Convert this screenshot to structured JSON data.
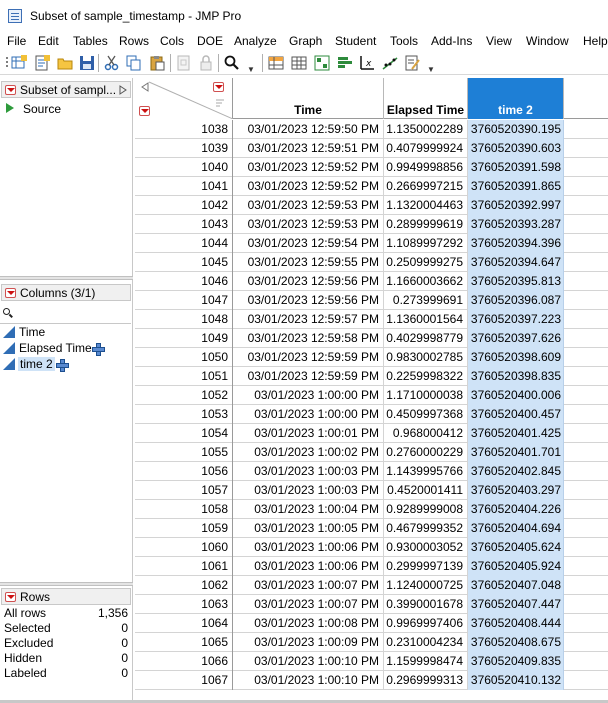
{
  "window": {
    "title": "Subset of sample_timestamp - JMP Pro"
  },
  "menu": [
    "File",
    "Edit",
    "Tables",
    "Rows",
    "Cols",
    "DOE",
    "Analyze",
    "Graph",
    "Student",
    "Tools",
    "Add-Ins",
    "View",
    "Window",
    "Help"
  ],
  "table_panel": {
    "title": "Subset of sampl...",
    "source_label": "Source"
  },
  "columns_panel": {
    "title": "Columns (3/1)",
    "search_value": "",
    "items": [
      {
        "name": "Time",
        "selected": false,
        "has_formula": false
      },
      {
        "name": "Elapsed Time",
        "selected": false,
        "has_formula": true
      },
      {
        "name": "time 2",
        "selected": true,
        "has_formula": true
      }
    ]
  },
  "rows_panel": {
    "title": "Rows",
    "stats": [
      {
        "label": "All rows",
        "value": "1,356"
      },
      {
        "label": "Selected",
        "value": "0"
      },
      {
        "label": "Excluded",
        "value": "0"
      },
      {
        "label": "Hidden",
        "value": "0"
      },
      {
        "label": "Labeled",
        "value": "0"
      }
    ]
  },
  "grid": {
    "headers": {
      "time": "Time",
      "elapsed": "Elapsed Time",
      "time2": "time 2"
    },
    "selected_column": "time 2",
    "selection_color": "#1e7fd6",
    "rows": [
      {
        "n": "1038",
        "time": "03/01/2023 12:59:50 PM",
        "elapsed": "1.1350002289",
        "time2": "3760520390.195"
      },
      {
        "n": "1039",
        "time": "03/01/2023 12:59:51 PM",
        "elapsed": "0.4079999924",
        "time2": "3760520390.603"
      },
      {
        "n": "1040",
        "time": "03/01/2023 12:59:52 PM",
        "elapsed": "0.9949998856",
        "time2": "3760520391.598"
      },
      {
        "n": "1041",
        "time": "03/01/2023 12:59:52 PM",
        "elapsed": "0.2669997215",
        "time2": "3760520391.865"
      },
      {
        "n": "1042",
        "time": "03/01/2023 12:59:53 PM",
        "elapsed": "1.1320004463",
        "time2": "3760520392.997"
      },
      {
        "n": "1043",
        "time": "03/01/2023 12:59:53 PM",
        "elapsed": "0.2899999619",
        "time2": "3760520393.287"
      },
      {
        "n": "1044",
        "time": "03/01/2023 12:59:54 PM",
        "elapsed": "1.1089997292",
        "time2": "3760520394.396"
      },
      {
        "n": "1045",
        "time": "03/01/2023 12:59:55 PM",
        "elapsed": "0.2509999275",
        "time2": "3760520394.647"
      },
      {
        "n": "1046",
        "time": "03/01/2023 12:59:56 PM",
        "elapsed": "1.1660003662",
        "time2": "3760520395.813"
      },
      {
        "n": "1047",
        "time": "03/01/2023 12:59:56 PM",
        "elapsed": "0.273999691",
        "time2": "3760520396.087"
      },
      {
        "n": "1048",
        "time": "03/01/2023 12:59:57 PM",
        "elapsed": "1.1360001564",
        "time2": "3760520397.223"
      },
      {
        "n": "1049",
        "time": "03/01/2023 12:59:58 PM",
        "elapsed": "0.4029998779",
        "time2": "3760520397.626"
      },
      {
        "n": "1050",
        "time": "03/01/2023 12:59:59 PM",
        "elapsed": "0.9830002785",
        "time2": "3760520398.609"
      },
      {
        "n": "1051",
        "time": "03/01/2023 12:59:59 PM",
        "elapsed": "0.2259998322",
        "time2": "3760520398.835"
      },
      {
        "n": "1052",
        "time": "03/01/2023 1:00:00 PM",
        "elapsed": "1.1710000038",
        "time2": "3760520400.006"
      },
      {
        "n": "1053",
        "time": "03/01/2023 1:00:00 PM",
        "elapsed": "0.4509997368",
        "time2": "3760520400.457"
      },
      {
        "n": "1054",
        "time": "03/01/2023 1:00:01 PM",
        "elapsed": "0.968000412",
        "time2": "3760520401.425"
      },
      {
        "n": "1055",
        "time": "03/01/2023 1:00:02 PM",
        "elapsed": "0.2760000229",
        "time2": "3760520401.701"
      },
      {
        "n": "1056",
        "time": "03/01/2023 1:00:03 PM",
        "elapsed": "1.1439995766",
        "time2": "3760520402.845"
      },
      {
        "n": "1057",
        "time": "03/01/2023 1:00:03 PM",
        "elapsed": "0.4520001411",
        "time2": "3760520403.297"
      },
      {
        "n": "1058",
        "time": "03/01/2023 1:00:04 PM",
        "elapsed": "0.9289999008",
        "time2": "3760520404.226"
      },
      {
        "n": "1059",
        "time": "03/01/2023 1:00:05 PM",
        "elapsed": "0.4679999352",
        "time2": "3760520404.694"
      },
      {
        "n": "1060",
        "time": "03/01/2023 1:00:06 PM",
        "elapsed": "0.9300003052",
        "time2": "3760520405.624"
      },
      {
        "n": "1061",
        "time": "03/01/2023 1:00:06 PM",
        "elapsed": "0.2999997139",
        "time2": "3760520405.924"
      },
      {
        "n": "1062",
        "time": "03/01/2023 1:00:07 PM",
        "elapsed": "1.1240000725",
        "time2": "3760520407.048"
      },
      {
        "n": "1063",
        "time": "03/01/2023 1:00:07 PM",
        "elapsed": "0.3990001678",
        "time2": "3760520407.447"
      },
      {
        "n": "1064",
        "time": "03/01/2023 1:00:08 PM",
        "elapsed": "0.9969997406",
        "time2": "3760520408.444"
      },
      {
        "n": "1065",
        "time": "03/01/2023 1:00:09 PM",
        "elapsed": "0.2310004234",
        "time2": "3760520408.675"
      },
      {
        "n": "1066",
        "time": "03/01/2023 1:00:10 PM",
        "elapsed": "1.1599998474",
        "time2": "3760520409.835"
      },
      {
        "n": "1067",
        "time": "03/01/2023 1:00:10 PM",
        "elapsed": "0.2969999313",
        "time2": "3760520410.132"
      }
    ]
  }
}
